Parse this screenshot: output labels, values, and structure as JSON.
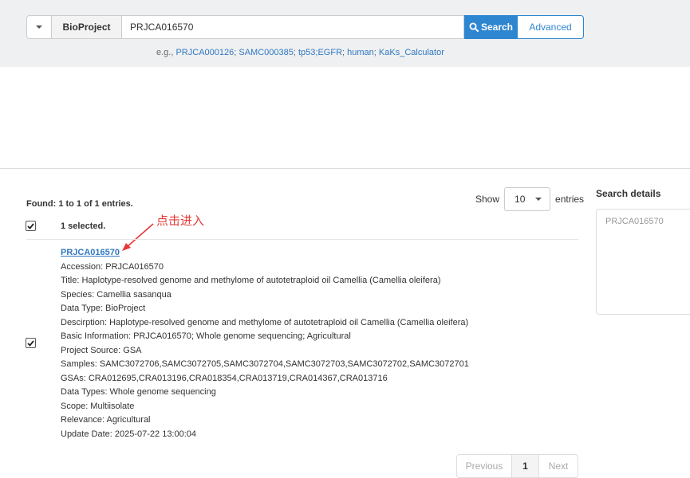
{
  "search": {
    "database": "BioProject",
    "query": "PRJCA016570",
    "search_label": "Search",
    "advanced_label": "Advanced",
    "examples_prefix": "e.g.,",
    "examples": [
      "PRJCA000126",
      "SAMC000385",
      "tp53;EGFR",
      "human",
      "KaKs_Calculator"
    ]
  },
  "results": {
    "found_text": "Found: 1 to 1 of 1 entries.",
    "show_label": "Show",
    "page_size": "10",
    "entries_label": "entries",
    "selected_text": "1 selected.",
    "annotation": "点击进入",
    "entry": {
      "accession_link": "PRJCA016570",
      "fields": [
        "Accession: PRJCA016570",
        "Title: Haplotype-resolved genome and methylome of autotetraploid oil Camellia (Camellia oleifera)",
        "Species: Camellia sasanqua",
        "Data Type: BioProject",
        "Descirption: Haplotype-resolved genome and methylome of autotetraploid oil Camellia (Camellia oleifera)",
        "Basic Information: PRJCA016570; Whole genome sequencing; Agricultural",
        "Project Source: GSA",
        "Samples: SAMC3072706,SAMC3072705,SAMC3072704,SAMC3072703,SAMC3072702,SAMC3072701",
        "GSAs: CRA012695,CRA013196,CRA018354,CRA013719,CRA014367,CRA013716",
        "Data Types: Whole genome sequencing",
        "Scope: Multiisolate",
        "Relevance: Agricultural",
        "Update Date: 2025-07-22 13:00:04"
      ]
    },
    "pagination": {
      "previous": "Previous",
      "current": "1",
      "next": "Next"
    }
  },
  "search_details": {
    "title": "Search details",
    "query": "PRJCA016570"
  },
  "colors": {
    "accent": "#2f86d0",
    "annotation": "#e53935",
    "band": "#eef0f2"
  }
}
